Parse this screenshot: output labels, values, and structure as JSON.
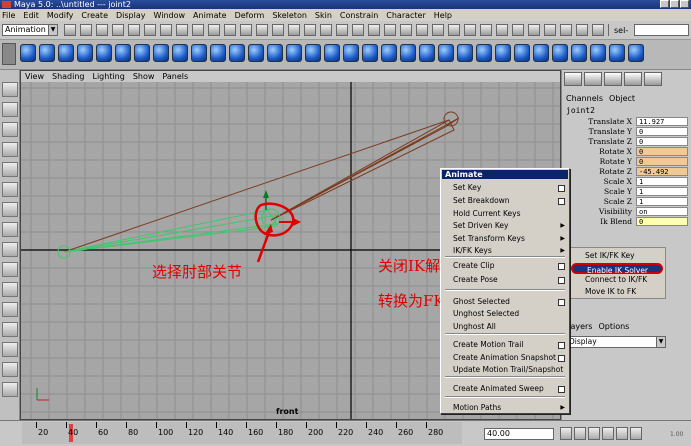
{
  "window": {
    "title": "Maya 5.0: ..\\untitled  ---  joint2"
  },
  "menubar": {
    "items": [
      "File",
      "Edit",
      "Modify",
      "Create",
      "Display",
      "Window",
      "Animate",
      "Deform",
      "Skeleton",
      "Skin",
      "Constrain",
      "Character",
      "Help"
    ]
  },
  "statusline": {
    "mode": "Animation",
    "sel_label": "sel-"
  },
  "viewport": {
    "menu": [
      "View",
      "Shading",
      "Lighting",
      "Show",
      "Panels"
    ],
    "camera_label": "front"
  },
  "annotations": {
    "select_elbow": "选择肘部关节",
    "close_ik_line1": "关闭IK解算器，",
    "close_ik_line2": "转换为FK模式。"
  },
  "channel_box": {
    "tabs": [
      "Channels",
      "Object"
    ],
    "node_name": "joint2",
    "channels": [
      {
        "label": "Translate X",
        "value": "11.927",
        "kind": "normal"
      },
      {
        "label": "Translate Y",
        "value": "0",
        "kind": "normal"
      },
      {
        "label": "Translate Z",
        "value": "0",
        "kind": "normal"
      },
      {
        "label": "Rotate X",
        "value": "0",
        "kind": "rot"
      },
      {
        "label": "Rotate Y",
        "value": "0",
        "kind": "rot"
      },
      {
        "label": "Rotate Z",
        "value": "-45.492",
        "kind": "rot"
      },
      {
        "label": "Scale X",
        "value": "1",
        "kind": "normal"
      },
      {
        "label": "Scale Y",
        "value": "1",
        "kind": "normal"
      },
      {
        "label": "Scale Z",
        "value": "1",
        "kind": "normal"
      },
      {
        "label": "Visibility",
        "value": "on",
        "kind": "normal"
      },
      {
        "label": "Ik Blend",
        "value": "0",
        "kind": "blend"
      }
    ]
  },
  "ik_fk_submenu": {
    "items": [
      {
        "label": "Set IK/FK Key",
        "highlighted": false
      },
      {
        "label": "Enable IK Solver",
        "highlighted": true
      },
      {
        "label": "Connect to IK/FK",
        "highlighted": false
      },
      {
        "label": "Move IK to FK",
        "highlighted": false
      }
    ]
  },
  "layers": {
    "tabs": [
      "Layers",
      "Options"
    ],
    "display": "Display"
  },
  "animate_menu": {
    "title": "Animate",
    "items": [
      {
        "label": "Set Key",
        "option": true,
        "submenu": false
      },
      {
        "label": "Set Breakdown",
        "option": true,
        "submenu": false
      },
      {
        "label": "Hold Current Keys",
        "option": false,
        "submenu": false
      },
      {
        "label": "Set Driven Key",
        "option": false,
        "submenu": true
      },
      {
        "label": "Set Transform Keys",
        "option": false,
        "submenu": true
      },
      {
        "label": "IK/FK Keys",
        "option": false,
        "submenu": true
      },
      {
        "label": "Create Clip",
        "option": true,
        "submenu": false
      },
      {
        "label": "Create Pose",
        "option": true,
        "submenu": false
      },
      {
        "label": "Ghost Selected",
        "option": true,
        "submenu": false
      },
      {
        "label": "Unghost Selected",
        "option": false,
        "submenu": false
      },
      {
        "label": "Unghost All",
        "option": false,
        "submenu": false
      },
      {
        "label": "Create Motion Trail",
        "option": true,
        "submenu": false
      },
      {
        "label": "Create Animation Snapshot",
        "option": true,
        "submenu": false
      },
      {
        "label": "Update Motion Trail/Snapshot",
        "option": false,
        "submenu": false
      },
      {
        "label": "Create Animated Sweep",
        "option": true,
        "submenu": false
      },
      {
        "label": "Motion Paths",
        "option": false,
        "submenu": true
      }
    ]
  },
  "timeline": {
    "ticks": [
      "20",
      "40",
      "60",
      "80",
      "100",
      "120",
      "140",
      "160",
      "180",
      "200",
      "220",
      "240",
      "260",
      "280"
    ],
    "end_time": "40.00",
    "fps": "1.00"
  },
  "colors": {
    "menu_highlight": "#17347c",
    "annotation_red": "#e00000",
    "rotate_field": "#f2c896",
    "ik_blend_field": "#ffffb0",
    "viewport_bg": "#a6a6a6"
  }
}
